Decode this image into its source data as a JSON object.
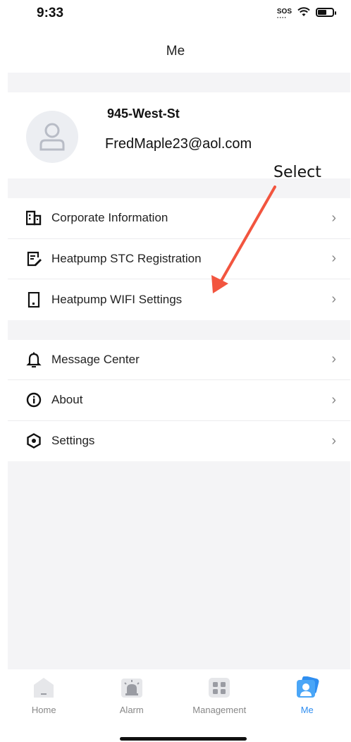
{
  "status_bar": {
    "time": "9:33",
    "sos_label": "SOS",
    "icons": [
      "sos-icon",
      "wifi-icon",
      "battery-icon"
    ]
  },
  "header": {
    "title": "Me"
  },
  "profile": {
    "name": "945-West-St",
    "email": "FredMaple23@aol.com",
    "avatar_icon": "user-icon"
  },
  "menu_groups": [
    {
      "items": [
        {
          "label": "Corporate Information",
          "icon": "building-icon"
        },
        {
          "label": "Heatpump STC Registration",
          "icon": "form-edit-icon"
        },
        {
          "label": "Heatpump WIFI Settings",
          "icon": "device-icon"
        }
      ]
    },
    {
      "items": [
        {
          "label": "Message Center",
          "icon": "bell-icon"
        },
        {
          "label": "About",
          "icon": "info-icon"
        },
        {
          "label": "Settings",
          "icon": "settings-hex-icon"
        }
      ]
    }
  ],
  "annotation": {
    "label": "Select",
    "color": "#f2553f"
  },
  "tabbar": {
    "tabs": [
      {
        "label": "Home",
        "icon": "home-icon",
        "active": false
      },
      {
        "label": "Alarm",
        "icon": "alarm-icon",
        "active": false
      },
      {
        "label": "Management",
        "icon": "grid-icon",
        "active": false
      },
      {
        "label": "Me",
        "icon": "profile-card-icon",
        "active": true
      }
    ],
    "active_color": "#2f8ef0",
    "inactive_color": "#888888"
  }
}
